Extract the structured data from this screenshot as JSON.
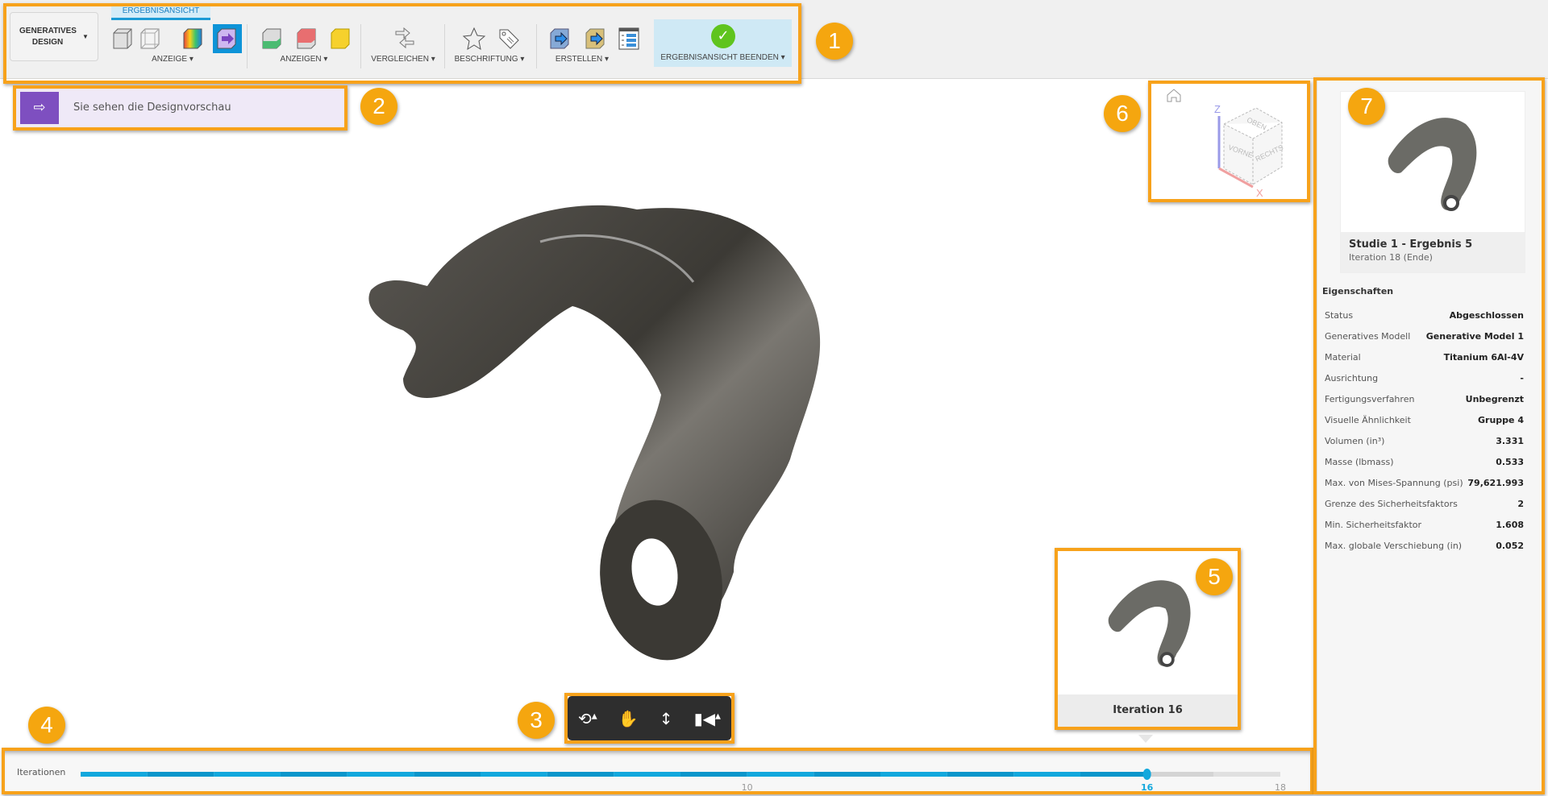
{
  "toolbar": {
    "workspace_button": "GENERATIVES DESIGN",
    "active_tab": "ERGEBNISANSICHT",
    "groups": [
      {
        "label": "ANZEIGE"
      },
      {
        "label": "ANZEIGEN"
      },
      {
        "label": "VERGLEICHEN"
      },
      {
        "label": "BESCHRIFTUNG"
      },
      {
        "label": "ERSTELLEN"
      }
    ],
    "finish_button": "ERGEBNISANSICHT BEENDEN"
  },
  "banner": {
    "text": "Sie sehen die Designvorschau"
  },
  "viewcube": {
    "top": "OBEN",
    "front": "VORNE",
    "right": "RECHTS",
    "axis_z": "Z",
    "axis_x": "X"
  },
  "result_card": {
    "title": "Studie 1 - Ergebnis 5",
    "subtitle": "Iteration 18 (Ende)"
  },
  "properties": {
    "heading": "Eigenschaften",
    "rows": [
      {
        "label": "Status",
        "value": "Abgeschlossen"
      },
      {
        "label": "Generatives Modell",
        "value": "Generative Model 1"
      },
      {
        "label": "Material",
        "value": "Titanium 6Al-4V"
      },
      {
        "label": "Ausrichtung",
        "value": "-"
      },
      {
        "label": "Fertigungsverfahren",
        "value": "Unbegrenzt"
      },
      {
        "label": "Visuelle Ähnlichkeit",
        "value": "Gruppe 4"
      },
      {
        "label": "Volumen (in³)",
        "value": "3.331"
      },
      {
        "label": "Masse (lbmass)",
        "value": "0.533"
      },
      {
        "label": "Max. von Mises-Spannung (psi)",
        "value": "79,621.993"
      },
      {
        "label": "Grenze des Sicherheitsfaktors",
        "value": "2"
      },
      {
        "label": "Min. Sicherheitsfaktor",
        "value": "1.608"
      },
      {
        "label": "Max. globale Verschiebung (in)",
        "value": "0.052"
      }
    ]
  },
  "iteration_preview": {
    "label": "Iteration 16"
  },
  "timeline": {
    "label": "Iterationen",
    "min": 0,
    "max": 18,
    "current": 16,
    "ticks": [
      "10",
      "16",
      "18"
    ],
    "accent": "#12a8dd"
  },
  "callouts": [
    "1",
    "2",
    "3",
    "4",
    "5",
    "6",
    "7"
  ],
  "nav_icons": [
    "orbit-icon",
    "pan-hand-icon",
    "zoom-icon",
    "camera-icon"
  ]
}
